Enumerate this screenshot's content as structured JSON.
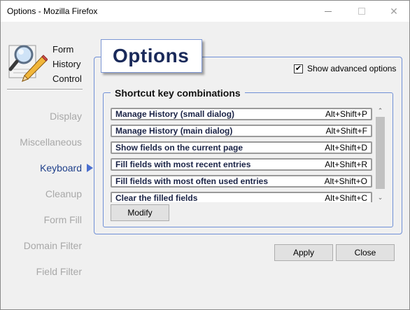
{
  "window": {
    "title": "Options - Mozilla Firefox",
    "controls": {
      "minimize_icon": "minimize-icon",
      "maximize_icon": "maximize-icon",
      "close_icon": "close-icon"
    }
  },
  "logo": {
    "icon": "magnifier-pencil-icon",
    "line1": "Form",
    "line2": "History",
    "line3": "Control"
  },
  "sidebar": {
    "items": [
      {
        "label": "Display",
        "active": false
      },
      {
        "label": "Miscellaneous",
        "active": false
      },
      {
        "label": "Keyboard",
        "active": true
      },
      {
        "label": "Cleanup",
        "active": false
      },
      {
        "label": "Form Fill",
        "active": false
      },
      {
        "label": "Domain Filter",
        "active": false
      },
      {
        "label": "Field Filter",
        "active": false
      }
    ]
  },
  "main": {
    "title": "Options",
    "advanced_options_label": "Show advanced options",
    "advanced_options_checked": true,
    "group_title": "Shortcut key combinations",
    "shortcuts": [
      {
        "command": "Manage History (small dialog)",
        "keys": "Alt+Shift+P"
      },
      {
        "command": "Manage History (main dialog)",
        "keys": "Alt+Shift+F"
      },
      {
        "command": "Show fields on the current page",
        "keys": "Alt+Shift+D"
      },
      {
        "command": "Fill fields with most recent entries",
        "keys": "Alt+Shift+R"
      },
      {
        "command": "Fill fields with most often used entries",
        "keys": "Alt+Shift+O"
      },
      {
        "command": "Clear the filled fields",
        "keys": "Alt+Shift+C"
      }
    ],
    "modify_label": "Modify"
  },
  "footer": {
    "apply_label": "Apply",
    "close_label": "Close"
  },
  "colors": {
    "accent": "#4a6fd0",
    "active_nav": "#1e3f8a",
    "inactive_nav": "#a8a8a8",
    "panel_border": "#6f8fd6"
  }
}
